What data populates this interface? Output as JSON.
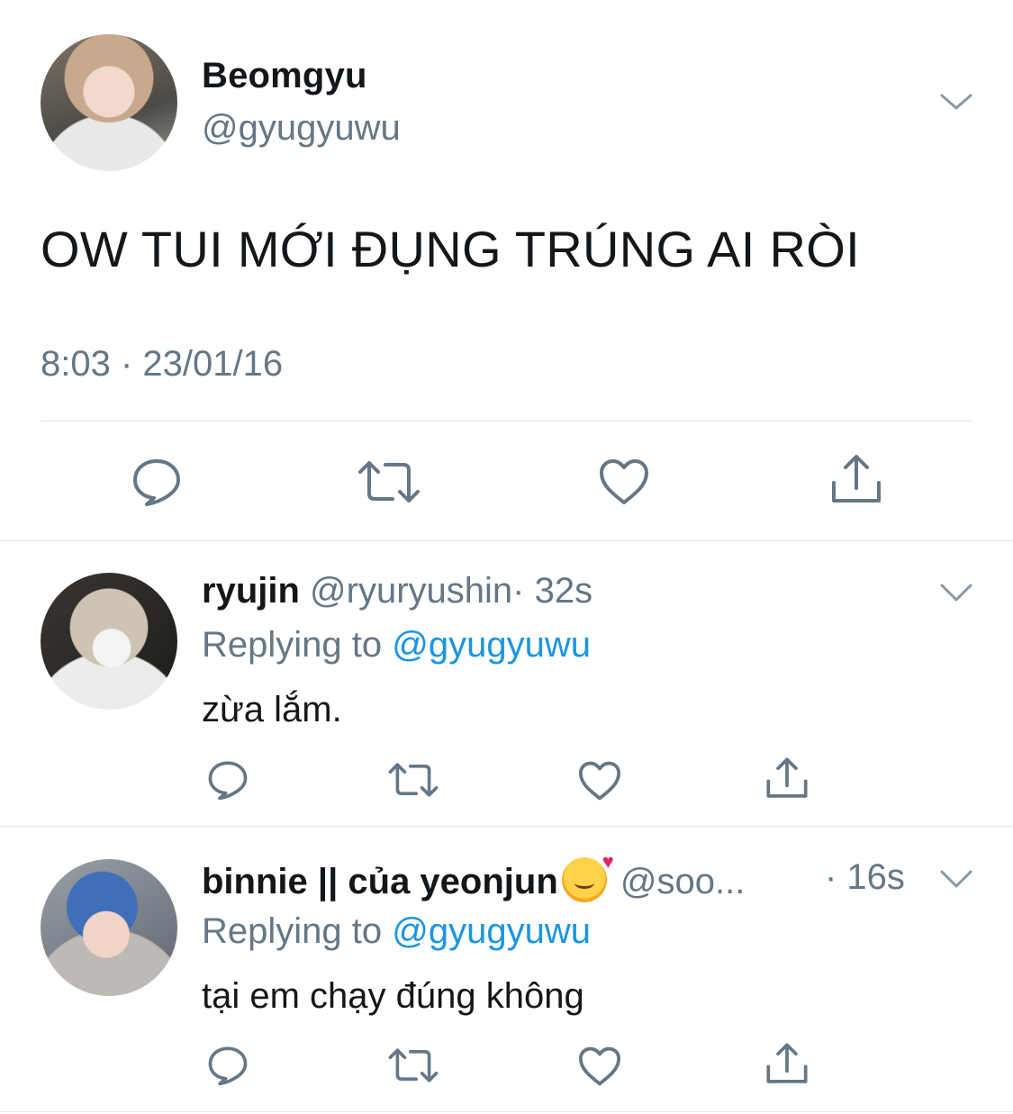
{
  "main_tweet": {
    "name": "Beomgyu",
    "handle": "@gyugyuwu",
    "text": "OW TUI MỚI ĐỤNG TRÚNG AI RÒI",
    "timestamp": "8:03 · 23/01/16",
    "menu_icon": "chevron-down-icon",
    "actions": [
      "reply-icon",
      "retweet-icon",
      "like-icon",
      "share-icon"
    ]
  },
  "replies": [
    {
      "name": "ryujin",
      "handle": "@ryuryushin",
      "time": "· 32s",
      "replying_prefix": "Replying to",
      "replying_to": "@gyugyuwu",
      "text": "zừa lắm."
    },
    {
      "name": "binnie || của yeonjun",
      "emoji": "smiling-face-with-hearts",
      "handle": "@soo...",
      "time": "· 16s",
      "replying_prefix": "Replying to",
      "replying_to": "@gyugyuwu",
      "text": "tại em chạy đúng không"
    }
  ],
  "colors": {
    "text": "#14171a",
    "secondary": "#657786",
    "link": "#1b95e0",
    "divider": "#e1e8ed"
  }
}
